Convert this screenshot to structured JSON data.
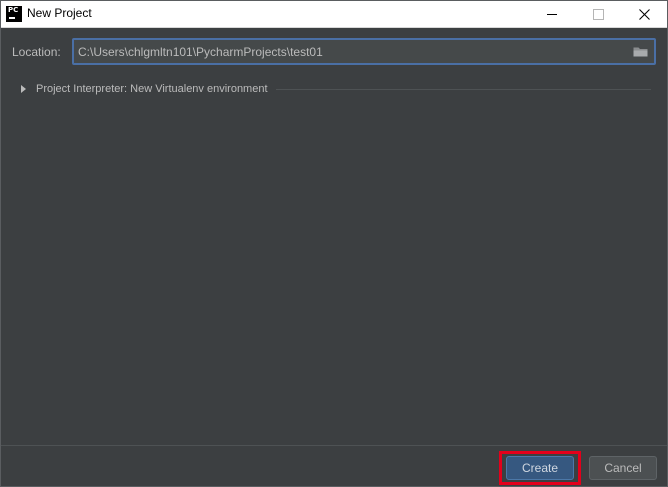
{
  "window": {
    "title": "New Project",
    "logo_text": "PC"
  },
  "location": {
    "label": "Location:",
    "value": "C:\\Users\\chlgmltn101\\PycharmProjects\\test01"
  },
  "interpreter": {
    "label": "Project Interpreter: New Virtualenv environment",
    "expanded": false
  },
  "buttons": {
    "create": "Create",
    "cancel": "Cancel"
  },
  "colors": {
    "background": "#3c3f41",
    "field_focus_border": "#4a6fa5",
    "primary_button": "#365880",
    "highlight_border": "#e3001b"
  }
}
